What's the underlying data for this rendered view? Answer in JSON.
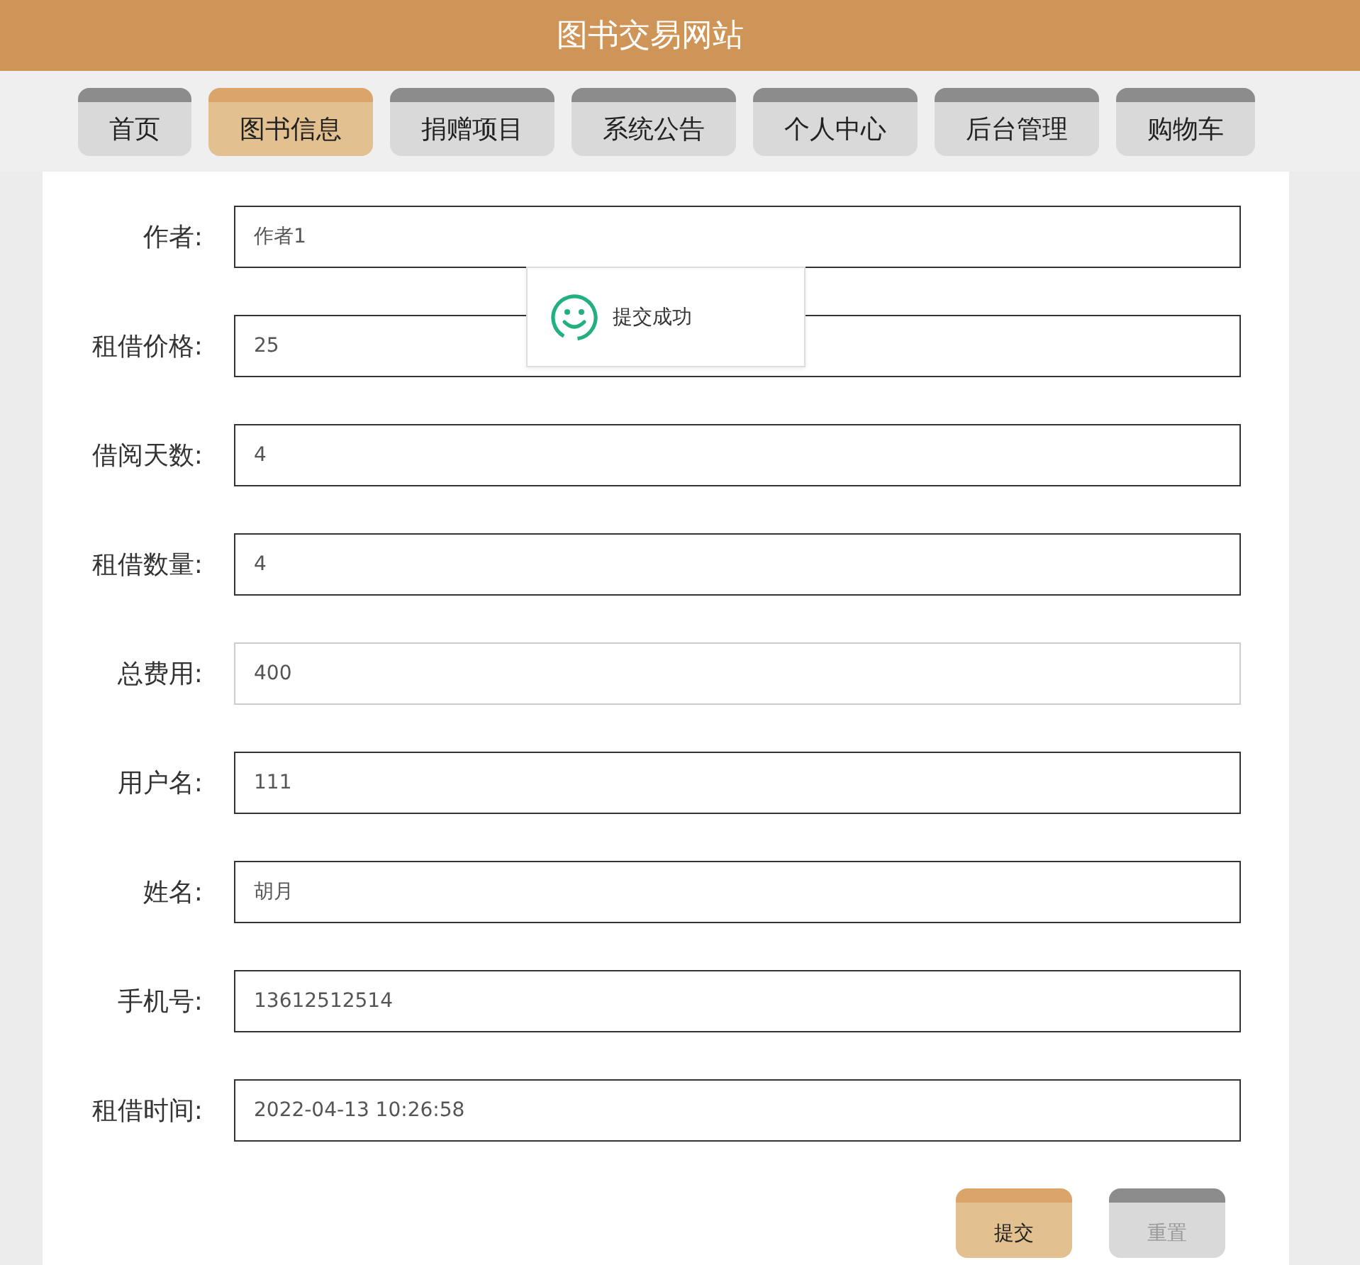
{
  "header": {
    "title": "图书交易网站"
  },
  "nav": {
    "tabs": [
      {
        "label": "首页",
        "selected": false
      },
      {
        "label": "图书信息",
        "selected": true
      },
      {
        "label": "捐赠项目",
        "selected": false
      },
      {
        "label": "系统公告",
        "selected": false
      },
      {
        "label": "个人中心",
        "selected": false
      },
      {
        "label": "后台管理",
        "selected": false
      },
      {
        "label": "购物车",
        "selected": false
      }
    ]
  },
  "form": {
    "fields": [
      {
        "label": "作者:",
        "value": "作者1",
        "disabled": false
      },
      {
        "label": "租借价格:",
        "value": "25",
        "disabled": false
      },
      {
        "label": "借阅天数:",
        "value": "4",
        "disabled": false
      },
      {
        "label": "租借数量:",
        "value": "4",
        "disabled": false
      },
      {
        "label": "总费用:",
        "value": "400",
        "disabled": true
      },
      {
        "label": "用户名:",
        "value": "111",
        "disabled": false
      },
      {
        "label": "姓名:",
        "value": "胡月",
        "disabled": false
      },
      {
        "label": "手机号:",
        "value": "13612512514",
        "disabled": false
      },
      {
        "label": "租借时间:",
        "value": "2022-04-13 10:26:58",
        "disabled": false
      }
    ],
    "buttons": [
      {
        "label": "提交",
        "kind": "primary"
      },
      {
        "label": "重置",
        "kind": "default"
      }
    ]
  },
  "toast": {
    "message": "提交成功"
  }
}
